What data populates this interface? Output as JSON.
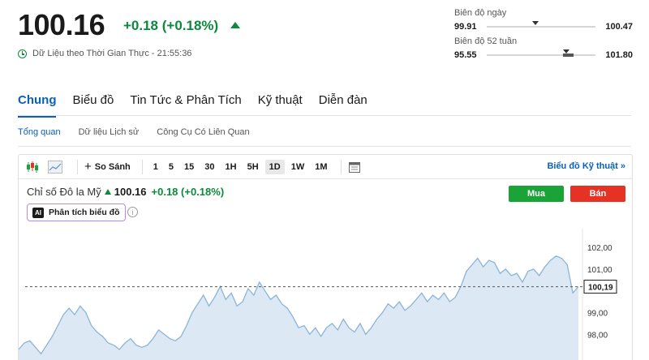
{
  "quote": {
    "price": "100.16",
    "change": "+0.18",
    "change_pct": "(+0.18%)",
    "realtime_label": "Dữ Liệu theo Thời Gian Thực",
    "realtime_time": "21:55:36"
  },
  "day_range": {
    "label": "Biên độ ngày",
    "low": "99.91",
    "high": "100.47",
    "current_fraction": 0.45
  },
  "week52_range": {
    "label": "Biên độ 52 tuần",
    "low": "95.55",
    "high": "101.80",
    "current_fraction": 0.73
  },
  "tabs": [
    {
      "label": "Chung",
      "active": true
    },
    {
      "label": "Biểu đồ"
    },
    {
      "label": "Tin Tức & Phân Tích"
    },
    {
      "label": "Kỹ thuật"
    },
    {
      "label": "Diễn đàn"
    }
  ],
  "subtabs": [
    {
      "label": "Tổng quan",
      "active": true
    },
    {
      "label": "Dữ liệu Lịch sử"
    },
    {
      "label": "Công Cụ Có Liên Quan"
    }
  ],
  "toolbar": {
    "compare_label": "So Sánh",
    "intervals": [
      "1",
      "5",
      "15",
      "30",
      "1H",
      "5H",
      "1D",
      "1W",
      "1M"
    ],
    "active_interval": "1D",
    "technical_link": "Biểu đồ Kỹ thuật »"
  },
  "chart_header": {
    "name": "Chỉ số Đô la Mỹ",
    "value": "100.16",
    "change": "+0.18",
    "change_pct": "(+0.18%)",
    "buy_label": "Mua",
    "sell_label": "Bán",
    "ai_badge": "AI",
    "ai_label": "Phân tích biểu đồ",
    "info_glyph": "i"
  },
  "colors": {
    "up": "#0a8a3a",
    "accent": "#0b5fbd",
    "buy": "#1aa336",
    "sell": "#e53224",
    "line": "#8ab4da",
    "area": "#dce9f5"
  },
  "chart_data": {
    "type": "area",
    "y_ticks": [
      "102,00",
      "101,00",
      "99,00",
      "98,00"
    ],
    "current_label": "100,19",
    "current_value": 100.19,
    "ylim": [
      97.45,
      102.45
    ],
    "values": [
      97.3,
      97.6,
      97.7,
      97.4,
      97.1,
      97.5,
      97.9,
      98.4,
      98.9,
      99.2,
      98.9,
      99.3,
      99.0,
      98.4,
      98.1,
      97.9,
      97.6,
      97.5,
      97.3,
      97.6,
      97.8,
      97.5,
      97.4,
      97.5,
      97.8,
      98.2,
      98.0,
      97.8,
      97.7,
      97.9,
      98.4,
      99.0,
      99.4,
      99.8,
      99.3,
      99.7,
      100.2,
      99.6,
      99.9,
      99.3,
      99.5,
      100.1,
      99.8,
      100.4,
      100.0,
      99.6,
      99.8,
      99.4,
      99.2,
      98.8,
      98.3,
      98.4,
      98.0,
      98.3,
      97.9,
      98.3,
      98.5,
      98.2,
      98.7,
      98.3,
      98.1,
      98.5,
      98.0,
      98.3,
      98.7,
      99.0,
      99.4,
      99.2,
      99.5,
      99.1,
      99.3,
      99.6,
      99.9,
      99.5,
      99.8,
      99.6,
      99.9,
      99.5,
      99.7,
      100.2,
      100.9,
      101.2,
      101.5,
      101.1,
      101.4,
      101.3,
      100.8,
      101.0,
      100.7,
      100.8,
      100.4,
      100.9,
      101.0,
      100.7,
      101.1,
      101.4,
      101.6,
      101.5,
      101.2,
      99.9,
      100.19
    ],
    "current_line": true,
    "grid": false
  }
}
